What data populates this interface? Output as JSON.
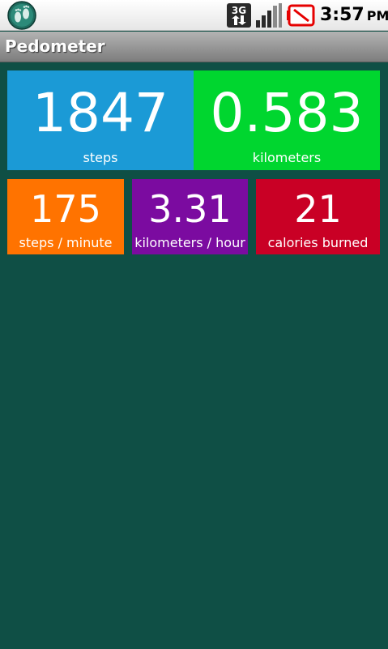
{
  "status_bar": {
    "app_icon": "footprints-icon",
    "network_icon": "3g-data-icon",
    "network_label": "3G",
    "signal_icon": "signal-bars-icon",
    "battery_icon": "battery-alert-icon",
    "time": "3:57",
    "ampm": "PM"
  },
  "app": {
    "title": "Pedometer"
  },
  "tiles": {
    "steps": {
      "value": "1847",
      "label": "steps",
      "color": "#1b9ad6"
    },
    "distance": {
      "value": "0.583",
      "label": "kilometers",
      "color": "#00d62f"
    },
    "pace": {
      "value": "175",
      "label": "steps / minute",
      "color": "#ff7300"
    },
    "speed": {
      "value": "3.31",
      "label": "kilometers / hour",
      "color": "#7b0ba0"
    },
    "calories": {
      "value": "21",
      "label": "calories burned",
      "color": "#c90025"
    }
  },
  "colors": {
    "background": "#0f4f45",
    "title_bar": "#999999"
  }
}
